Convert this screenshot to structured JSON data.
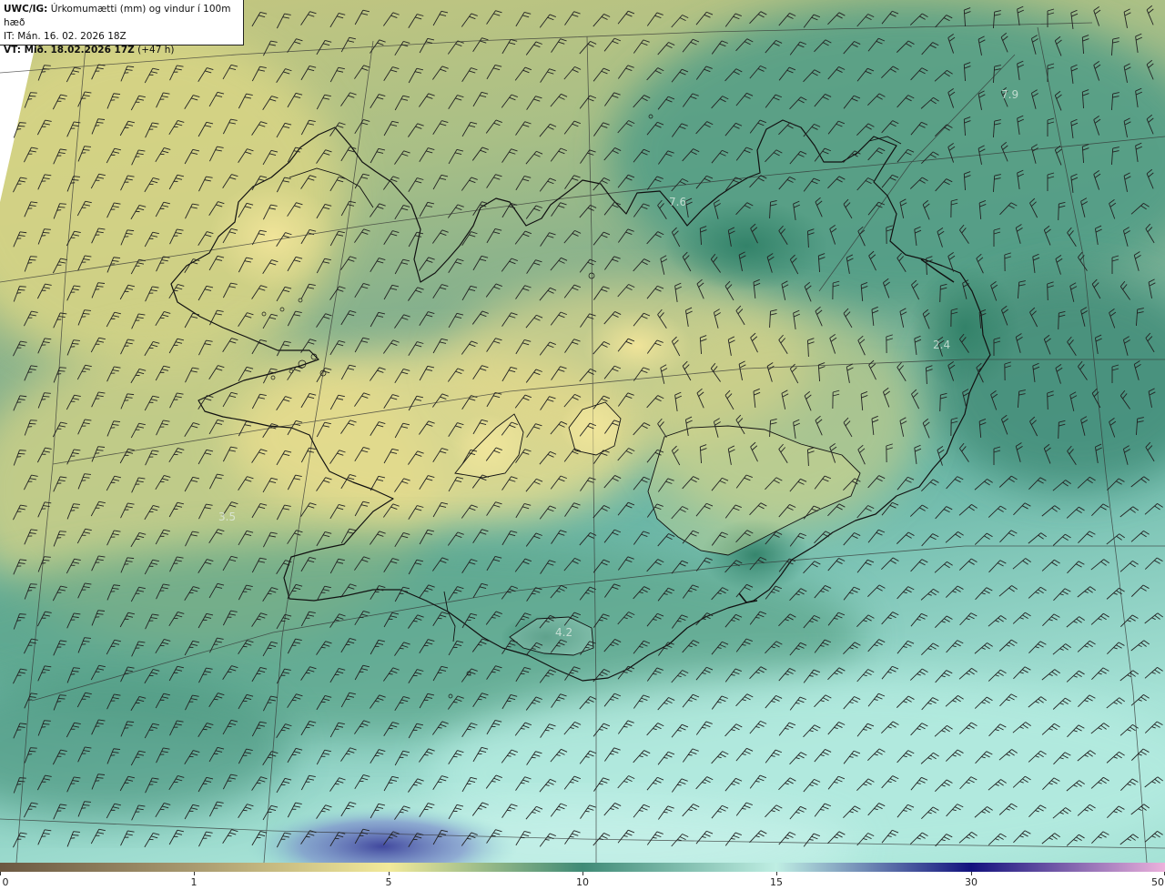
{
  "header": {
    "line1_bold": "UWC/IG:",
    "line1_rest": " Úrkomumætti (mm) og vindur í 100m hæð",
    "line2": "IT: Mán. 16. 02. 2026 18Z",
    "line3_bold": "VT: Mið. 18.02.2026 17Z",
    "line3_rest": " (+47 h)"
  },
  "colorbar": {
    "segments": [
      {
        "from": "#6b5842",
        "to": "#a99a70"
      },
      {
        "from": "#a99a70",
        "to": "#f2ea9a"
      },
      {
        "from": "#f2ea9a",
        "to": "#3f8a76"
      },
      {
        "from": "#3f8a76",
        "to": "#bfeee3"
      },
      {
        "from": "#bfeee3",
        "to": "#12127e"
      },
      {
        "from": "#12127e",
        "to": "#ecb2dc"
      },
      {
        "from": "#ecb2dc",
        "to": "#c24fb8"
      }
    ],
    "labels": [
      "0",
      "1",
      "5",
      "10",
      "15",
      "30",
      "50"
    ]
  },
  "map_labels": [
    "7.9",
    "7.6",
    "2.4",
    "3.5",
    "4.2"
  ],
  "colors": {
    "low_precip": "#e9dd8e",
    "mid_precip": "#4a9480",
    "high_precip": "#bfeee3",
    "heavy_precip": "#4a4fb0",
    "coastline": "#111111",
    "wind_barb": "#222222",
    "grid_line": "#333333"
  },
  "icons": {
    "wind_barb": "wind-barb-icon"
  }
}
